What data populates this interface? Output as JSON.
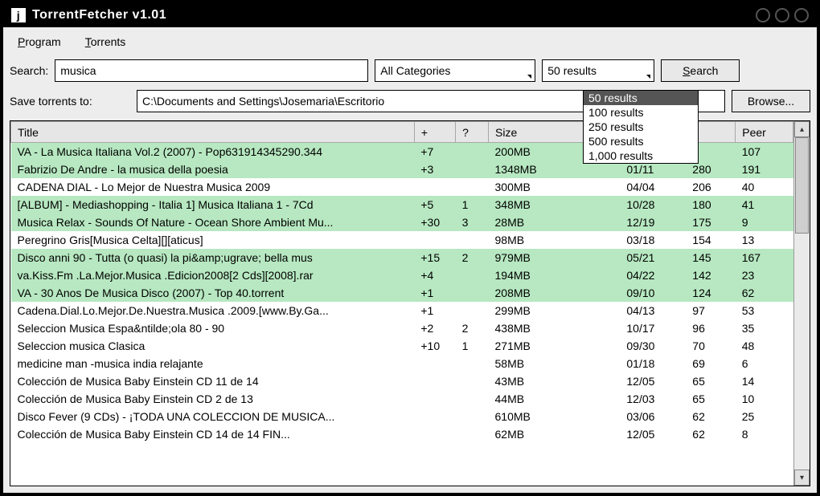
{
  "window": {
    "title": "TorrentFetcher  v1.01"
  },
  "menu": {
    "program": "Program",
    "torrents": "Torrents"
  },
  "search": {
    "label": "Search:",
    "value": "musica",
    "category": "All Categories",
    "results_selected": "50 results",
    "button": "Search"
  },
  "results_options": [
    "50 results",
    "100 results",
    "250 results",
    "500 results",
    "1,000 results"
  ],
  "save": {
    "label": "Save torrents to:",
    "path": "C:\\Documents and Settings\\Josemaria\\Escritorio",
    "browse": "Browse..."
  },
  "columns": {
    "title": "Title",
    "plus": "+",
    "q": "?",
    "size": "Size",
    "date": "",
    "seed": "",
    "peer": "Peer"
  },
  "rows": [
    {
      "hl": true,
      "title": "VA - La Musica Italiana Vol.2 (2007) - Pop631914345290.344",
      "plus": "+7",
      "q": "",
      "size": "200MB",
      "date": "",
      "seed": "",
      "peer": "107"
    },
    {
      "hl": true,
      "title": "Fabrizio De Andre - la musica della poesia",
      "plus": "+3",
      "q": "",
      "size": "1348MB",
      "date": "01/11",
      "seed": "280",
      "peer": "191"
    },
    {
      "hl": false,
      "title": "CADENA DIAL - Lo Mejor de Nuestra Musica 2009",
      "plus": "",
      "q": "",
      "size": "300MB",
      "date": "04/04",
      "seed": "206",
      "peer": "40"
    },
    {
      "hl": true,
      "title": "[ALBUM] - Mediashopping - Italia 1] Musica Italiana 1 - 7Cd",
      "plus": "+5",
      "q": "1",
      "size": "348MB",
      "date": "10/28",
      "seed": "180",
      "peer": "41"
    },
    {
      "hl": true,
      "title": "Musica Relax - Sounds Of Nature - Ocean Shore Ambient Mu...",
      "plus": "+30",
      "q": "3",
      "size": "28MB",
      "date": "12/19",
      "seed": "175",
      "peer": "9"
    },
    {
      "hl": false,
      "title": "Peregrino Gris[Musica Celta][][aticus]",
      "plus": "",
      "q": "",
      "size": "98MB",
      "date": "03/18",
      "seed": "154",
      "peer": "13"
    },
    {
      "hl": true,
      "title": "Disco anni 90 - Tutta (o quasi) la pi&amp;ugrave; bella mus",
      "plus": "+15",
      "q": "2",
      "size": "979MB",
      "date": "05/21",
      "seed": "145",
      "peer": "167"
    },
    {
      "hl": true,
      "title": "va.Kiss.Fm .La.Mejor.Musica .Edicion2008[2 Cds][2008].rar",
      "plus": "+4",
      "q": "",
      "size": "194MB",
      "date": "04/22",
      "seed": "142",
      "peer": "23"
    },
    {
      "hl": true,
      "title": "VA - 30 Anos De Musica Disco (2007) - Top 40.torrent",
      "plus": "+1",
      "q": "",
      "size": "208MB",
      "date": "09/10",
      "seed": "124",
      "peer": "62"
    },
    {
      "hl": false,
      "title": "Cadena.Dial.Lo.Mejor.De.Nuestra.Musica .2009.[www.By.Ga...",
      "plus": "+1",
      "q": "",
      "size": "299MB",
      "date": "04/13",
      "seed": "97",
      "peer": "53"
    },
    {
      "hl": false,
      "title": "Seleccion Musica Espa&ntilde;ola 80 - 90",
      "plus": "+2",
      "q": "2",
      "size": "438MB",
      "date": "10/17",
      "seed": "96",
      "peer": "35"
    },
    {
      "hl": false,
      "title": "Seleccion musica Clasica",
      "plus": "+10",
      "q": "1",
      "size": "271MB",
      "date": "09/30",
      "seed": "70",
      "peer": "48"
    },
    {
      "hl": false,
      "title": "medicine man -musica india relajante",
      "plus": "",
      "q": "",
      "size": "58MB",
      "date": "01/18",
      "seed": "69",
      "peer": "6"
    },
    {
      "hl": false,
      "title": "Colección de Musica Baby Einstein CD 11 de 14",
      "plus": "",
      "q": "",
      "size": "43MB",
      "date": "12/05",
      "seed": "65",
      "peer": "14"
    },
    {
      "hl": false,
      "title": "Colección de Musica Baby Einstein CD 2 de 13",
      "plus": "",
      "q": "",
      "size": "44MB",
      "date": "12/03",
      "seed": "65",
      "peer": "10"
    },
    {
      "hl": false,
      "title": "Disco Fever (9 CDs) - ¡TODA UNA COLECCION DE MUSICA...",
      "plus": "",
      "q": "",
      "size": "610MB",
      "date": "03/06",
      "seed": "62",
      "peer": "25"
    },
    {
      "hl": false,
      "title": "Colección de Musica Baby Einstein CD 14 de 14 FIN...",
      "plus": "",
      "q": "",
      "size": "62MB",
      "date": "12/05",
      "seed": "62",
      "peer": "8"
    }
  ]
}
